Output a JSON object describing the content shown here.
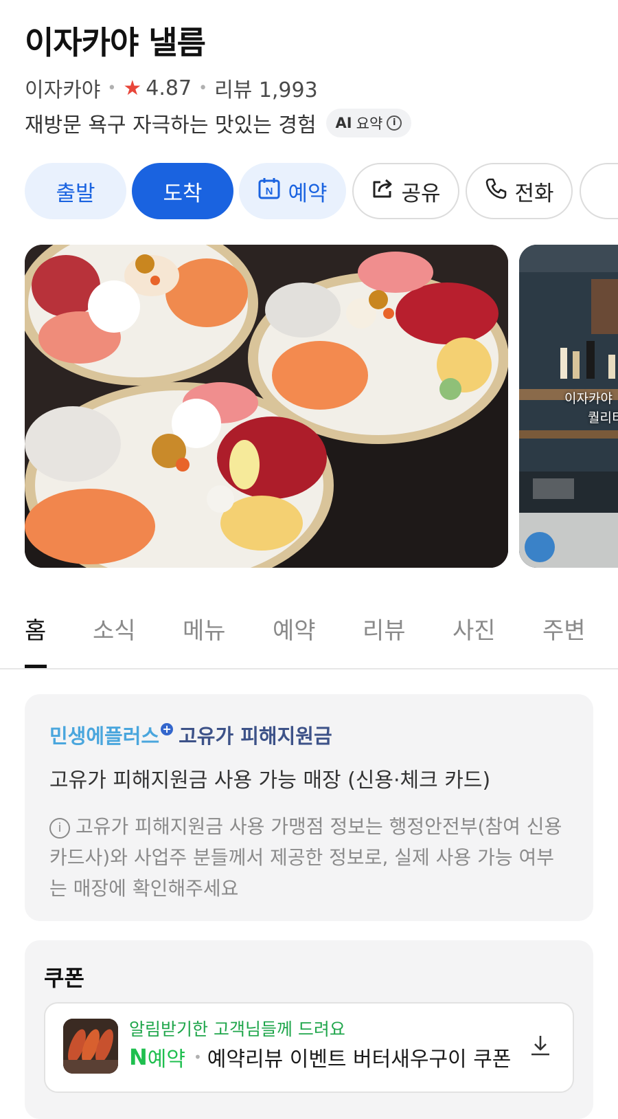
{
  "place": {
    "name": "이자카야 낼름",
    "category": "이자카야",
    "rating": "4.87",
    "review_label": "리뷰 1,993",
    "summary": "재방문 욕구 자극하는 맛있는 경험",
    "ai_badge_strong": "AI",
    "ai_badge_label": "요약"
  },
  "actions": {
    "depart": "출발",
    "arrive": "도착",
    "reserve": "예약",
    "share": "공유",
    "call": "전화"
  },
  "photo_side_caption": [
    "이자카야",
    "퀄리티"
  ],
  "tabs": [
    "홈",
    "소식",
    "메뉴",
    "예약",
    "리뷰",
    "사진",
    "주변"
  ],
  "active_tab_index": 0,
  "support_card": {
    "brand_part1": "민생에플러스",
    "brand_part2": "고유가 피해지원금",
    "main_text": "고유가 피해지원금 사용 가능 매장 (신용·체크 카드)",
    "note": "고유가 피해지원금 사용 가맹점 정보는 행정안전부(참여 신용카드사)와 사업주 분들께서 제공한 정보로, 실제 사용 가능 여부는 매장에 확인해주세요"
  },
  "coupon": {
    "section_title": "쿠폰",
    "subtitle": "알림받기한 고객님들께 드려요",
    "logo": "N",
    "tag": "예약",
    "text": "예약리뷰 이벤트 버터새우구이 쿠폰"
  },
  "colors": {
    "accent": "#1a63e0",
    "accent_light": "#e9f1fd",
    "star": "#e8463a",
    "naver_green": "#1fbf4f"
  }
}
